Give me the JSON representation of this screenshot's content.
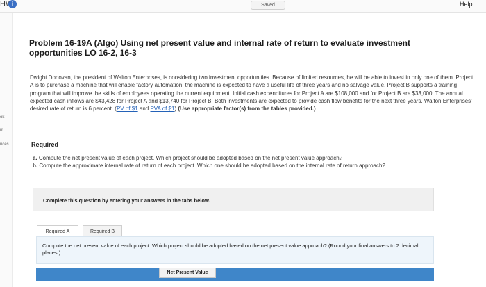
{
  "topbar": {
    "hw_label": "HW",
    "info_icon": "i",
    "saved_label": "Saved",
    "help_label": "Help"
  },
  "sidebar": {
    "items": [
      "ok",
      "nt",
      "nces"
    ]
  },
  "problem": {
    "title": "Problem 16-19A (Algo) Using net present value and internal rate of return to evaluate investment opportunities LO 16-2, 16-3",
    "body": "Dwight Donovan, the president of Walton Enterprises, is considering two investment opportunities. Because of limited resources, he will be able to invest in only one of them. Project A is to purchase a machine that will enable factory automation; the machine is expected to have a useful life of three years and no salvage value. Project B supports a training program that will improve the skills of employees operating the current equipment. Initial cash expenditures for Project A are $108,000 and for Project B are $33,000. The annual expected cash inflows are $43,428 for Project A and $13,740 for Project B. Both investments are expected to provide cash flow benefits for the next three years. Walton Enterprises' desired rate of return is 6 percent.",
    "link_pv": "PV of $1",
    "link_and": "and",
    "link_pva": "PVA of $1",
    "instruction": "(Use appropriate factor(s) from the tables provided.)"
  },
  "required": {
    "heading": "Required",
    "items": [
      {
        "letter": "a.",
        "text": "Compute the net present value of each project. Which project should be adopted based on the net present value approach?"
      },
      {
        "letter": "b.",
        "text": "Compute the approximate internal rate of return of each project. Which one should be adopted based on the internal rate of return approach?"
      }
    ]
  },
  "complete_box": {
    "text": "Complete this question by entering your answers in the tabs below."
  },
  "tabs": [
    {
      "label": "Required A"
    },
    {
      "label": "Required B"
    }
  ],
  "answer": {
    "prompt": "Compute the net present value of each project. Which project should be adopted based on the net present value approach? (Round your final answers to 2 decimal places.)",
    "table_header": "Net Present Value"
  },
  "colors": {
    "link": "#2462b8",
    "table_bar": "#3f86c9",
    "answer_bg": "#eef5fb"
  }
}
